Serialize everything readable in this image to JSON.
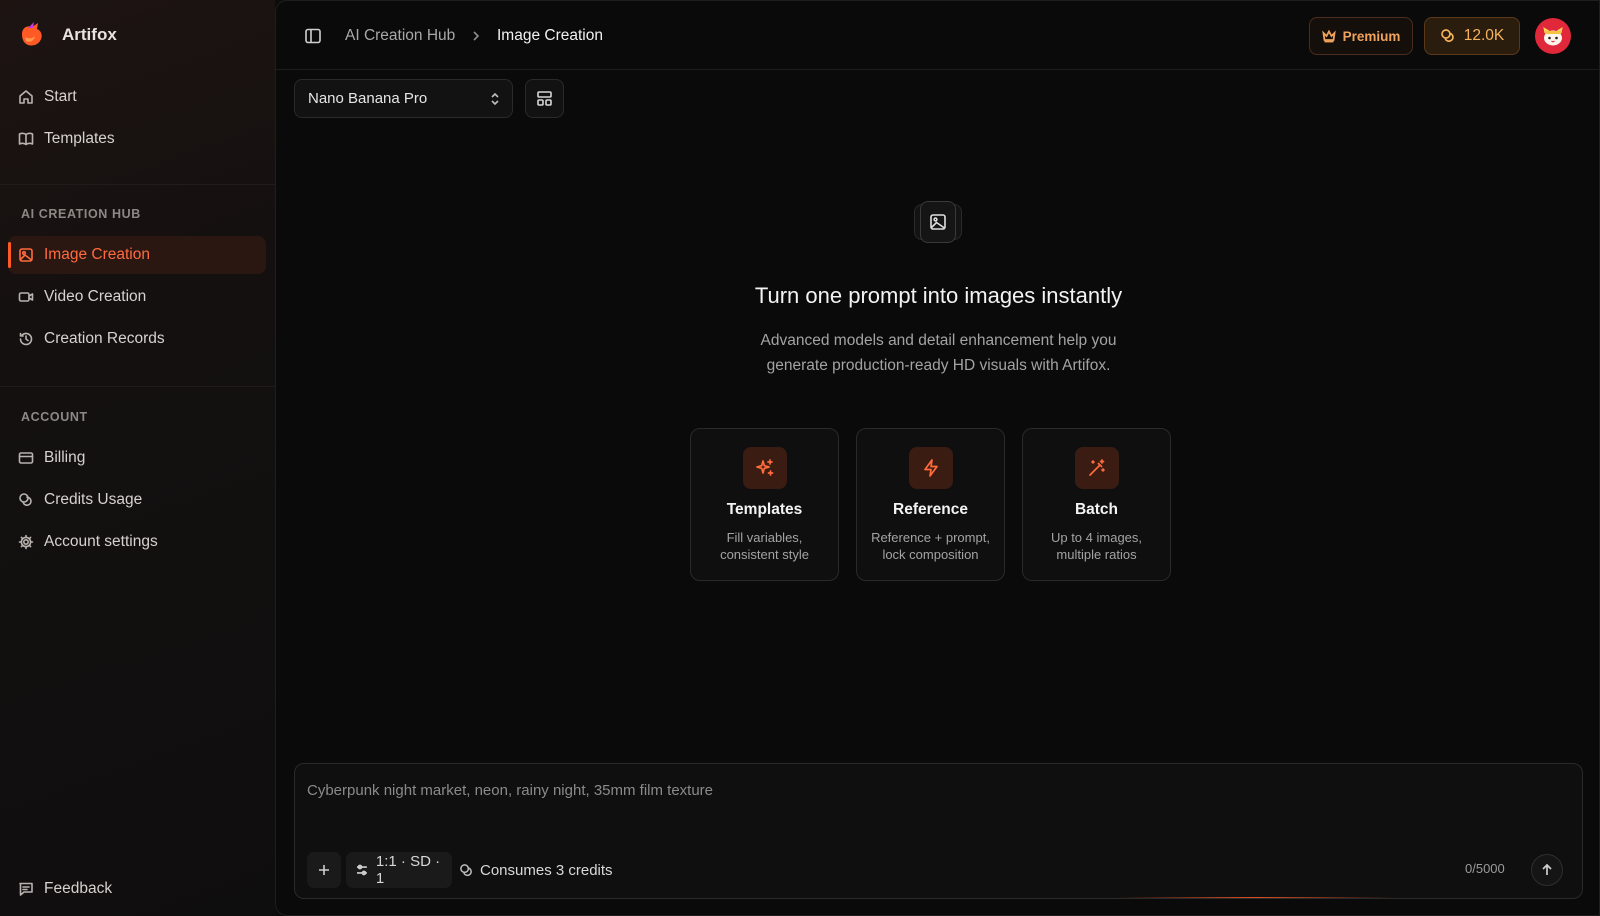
{
  "brand": {
    "name": "Artifox"
  },
  "sidebar": {
    "primary": [
      {
        "label": "Start",
        "icon": "home-icon"
      },
      {
        "label": "Templates",
        "icon": "book-icon"
      }
    ],
    "hub_label": "AI CREATION HUB",
    "hub_items": [
      {
        "label": "Image Creation",
        "icon": "image-icon",
        "active": true
      },
      {
        "label": "Video Creation",
        "icon": "video-icon"
      },
      {
        "label": "Creation Records",
        "icon": "history-icon"
      }
    ],
    "account_label": "ACCOUNT",
    "account_items": [
      {
        "label": "Billing",
        "icon": "card-icon"
      },
      {
        "label": "Credits Usage",
        "icon": "coins-icon"
      },
      {
        "label": "Account settings",
        "icon": "gear-icon"
      }
    ],
    "feedback": {
      "label": "Feedback",
      "icon": "feedback-icon"
    }
  },
  "header": {
    "breadcrumb": [
      "AI Creation Hub",
      "Image Creation"
    ],
    "premium_label": "Premium",
    "credits": "12.0K"
  },
  "toolbar": {
    "model": "Nano Banana Pro"
  },
  "hero": {
    "title": "Turn one prompt into images instantly",
    "subtitle_line1": "Advanced models and detail enhancement help you",
    "subtitle_line2": "generate production-ready HD visuals with Artifox."
  },
  "cards": [
    {
      "title": "Templates",
      "desc1": "Fill variables,",
      "desc2": "consistent style",
      "icon": "sparkles-icon"
    },
    {
      "title": "Reference",
      "desc1": "Reference + prompt,",
      "desc2": "lock composition",
      "icon": "lightning-icon"
    },
    {
      "title": "Batch",
      "desc1": "Up to 4 images,",
      "desc2": "multiple ratios",
      "icon": "magic-wand-icon"
    }
  ],
  "composer": {
    "placeholder": "Cyberpunk night market, neon, rainy night, 35mm film texture",
    "value": "",
    "settings": "1:1 · SD · 1",
    "consumes": "Consumes 3 credits",
    "counter": "0/5000"
  },
  "colors": {
    "accent": "#ff5a26",
    "gold": "#f6b25c",
    "background": "#0a0a0a"
  }
}
